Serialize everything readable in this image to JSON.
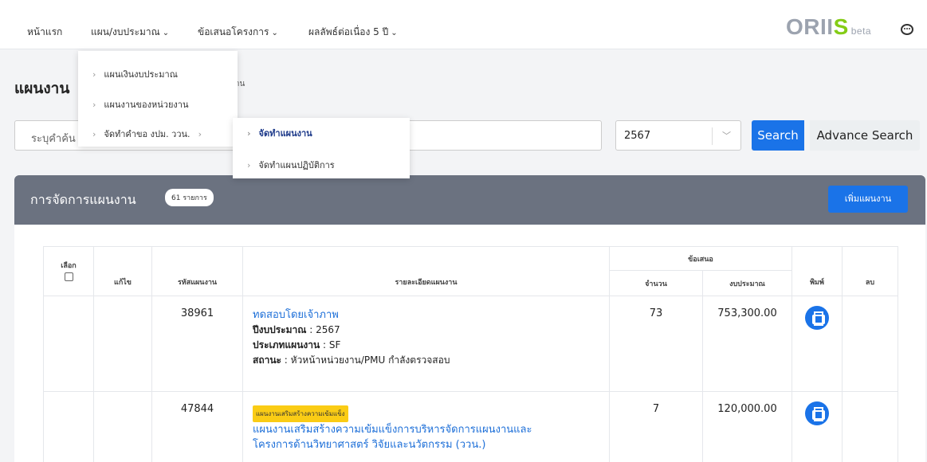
{
  "nav": {
    "home": "หน้าแรก",
    "plan_budget": "แผน/งบประมาณ",
    "project_proposal": "ข้อเสนอโครงการ",
    "continuous_results": "ผลลัพธ์ต่อเนื่อง 5 ปี",
    "logo_main": "ORII",
    "logo_s": "S",
    "logo_beta": "beta"
  },
  "dropdown_plan": {
    "items": [
      "แผนเงินงบประมาณ",
      "แผนงานของหน่วยงาน",
      "จัดทำคำขอ งปม. ววน."
    ]
  },
  "dropdown_sub": {
    "items": [
      "จัดทำแผนงาน",
      "จัดทำแผนปฏิบัติการ"
    ]
  },
  "page": {
    "title": "แผนงาน",
    "subtitle": "งาน"
  },
  "search": {
    "placeholder": "ระบุคำค้น",
    "year": "2567",
    "search_label": "Search",
    "advance_label": "Advance Search"
  },
  "panel": {
    "title": "การจัดการแผนงาน",
    "count_badge": "61 รายการ",
    "add_label": "เพิ่มแผนงาน"
  },
  "table": {
    "headers": {
      "select": "เลือก",
      "edit": "แก้ไข",
      "code": "รหัสแผนงาน",
      "detail": "รายละเอียดแผนงาน",
      "proposal": "ข้อเสนอ",
      "amount": "จำนวน",
      "budget": "งบประมาณ",
      "print": "พิมพ์",
      "delete": "ลบ"
    },
    "rows": [
      {
        "code": "38961",
        "tag": "",
        "title": "ทดสอบโดยเจ้าภาพ",
        "fiscal_label": "ปีงบประมาณ",
        "fiscal_value": " : 2567",
        "type_label": "ประเภทแผนงาน",
        "type_value": " : SF",
        "status_label": "สถานะ",
        "status_value": " :  หัวหน้าหน่วยงาน/PMU กำลังตรวจสอบ",
        "amount": "73",
        "budget": "753,300.00"
      },
      {
        "code": "47844",
        "tag": "แผนงานเสริมสร้างความเข้มแข็ง",
        "title_line1": "แผนงานเสริมสร้างความเข้มแข็งการบริหารจัดการแผนงานและ",
        "title_line2": "โครงการด้านวิทยาศาสตร์ วิจัยและนวัตกรรม (ววน.)",
        "amount": "7",
        "budget": "120,000.00"
      }
    ]
  },
  "colors": {
    "primary": "#1a73e8",
    "panel_header": "#6b7280",
    "tag_yellow": "#facc15",
    "link": "#1d6fd8"
  }
}
